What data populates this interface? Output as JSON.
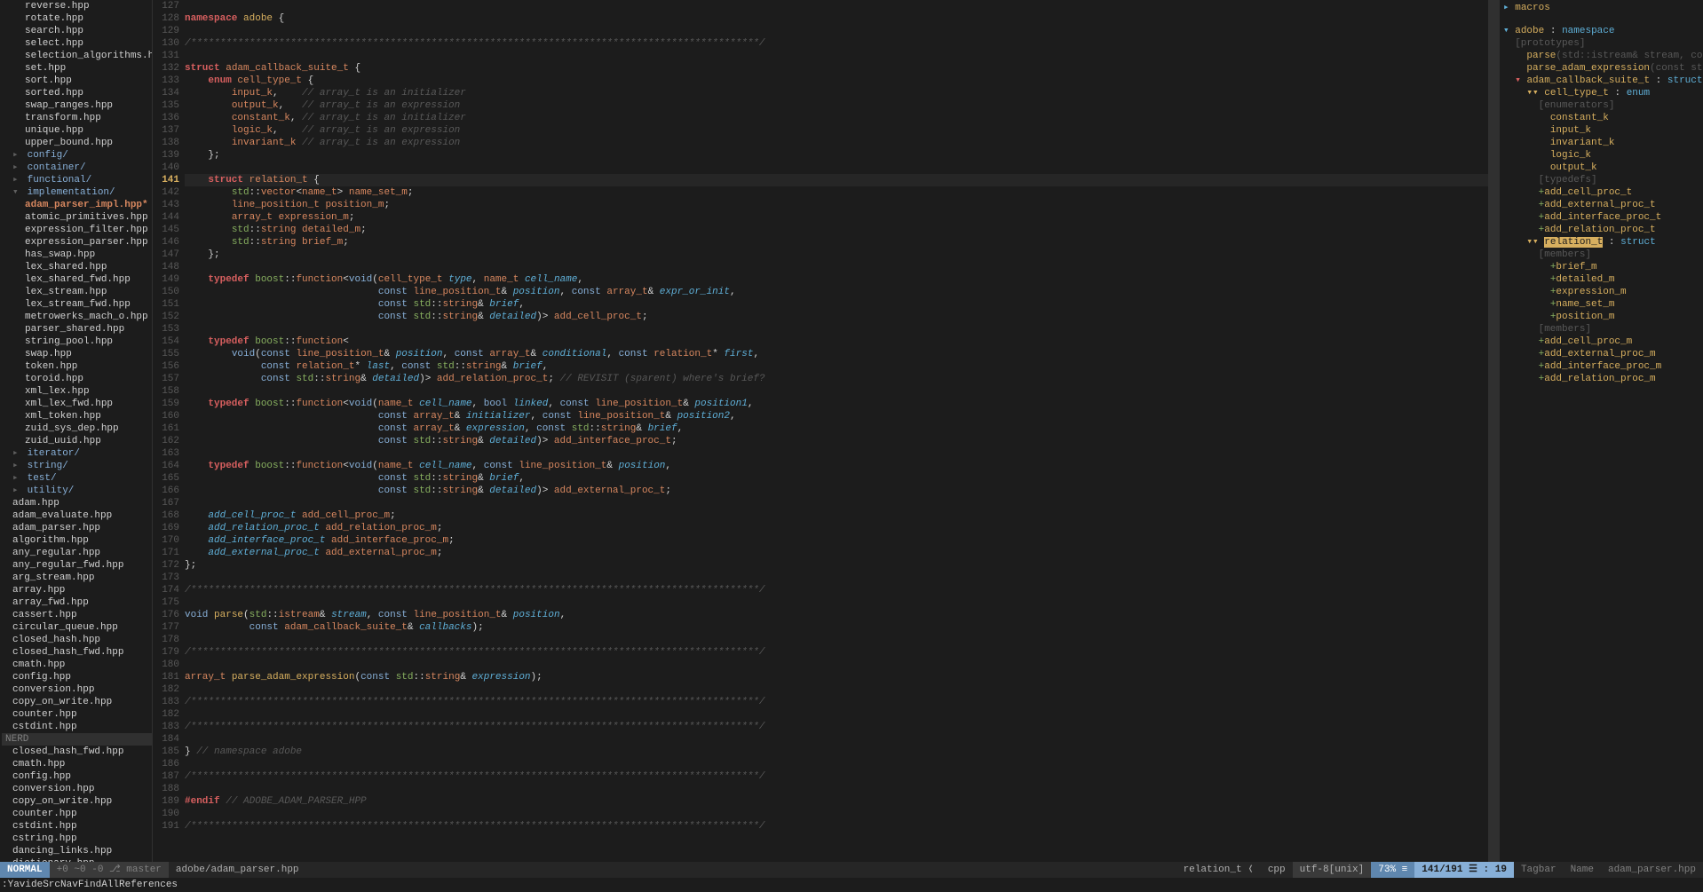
{
  "file_tree": {
    "items": [
      {
        "text": "reverse.hpp",
        "indent": 2
      },
      {
        "text": "rotate.hpp",
        "indent": 2
      },
      {
        "text": "search.hpp",
        "indent": 2
      },
      {
        "text": "select.hpp",
        "indent": 2
      },
      {
        "text": "selection_algorithms.hpp",
        "indent": 2
      },
      {
        "text": "set.hpp",
        "indent": 2
      },
      {
        "text": "sort.hpp",
        "indent": 2
      },
      {
        "text": "sorted.hpp",
        "indent": 2
      },
      {
        "text": "swap_ranges.hpp",
        "indent": 2
      },
      {
        "text": "transform.hpp",
        "indent": 2
      },
      {
        "text": "unique.hpp",
        "indent": 2
      },
      {
        "text": "upper_bound.hpp",
        "indent": 2
      },
      {
        "text": "config/",
        "indent": 1,
        "dir": true,
        "arrow": "▸"
      },
      {
        "text": "container/",
        "indent": 1,
        "dir": true,
        "arrow": "▸"
      },
      {
        "text": "functional/",
        "indent": 1,
        "dir": true,
        "arrow": "▸"
      },
      {
        "text": "implementation/",
        "indent": 1,
        "dir": true,
        "arrow": "▾"
      },
      {
        "text": "adam_parser_impl.hpp*",
        "indent": 2,
        "active": true
      },
      {
        "text": "atomic_primitives.hpp",
        "indent": 2
      },
      {
        "text": "expression_filter.hpp",
        "indent": 2
      },
      {
        "text": "expression_parser.hpp",
        "indent": 2
      },
      {
        "text": "has_swap.hpp",
        "indent": 2
      },
      {
        "text": "lex_shared.hpp",
        "indent": 2
      },
      {
        "text": "lex_shared_fwd.hpp",
        "indent": 2
      },
      {
        "text": "lex_stream.hpp",
        "indent": 2
      },
      {
        "text": "lex_stream_fwd.hpp",
        "indent": 2
      },
      {
        "text": "metrowerks_mach_o.hpp",
        "indent": 2
      },
      {
        "text": "parser_shared.hpp",
        "indent": 2
      },
      {
        "text": "string_pool.hpp",
        "indent": 2
      },
      {
        "text": "swap.hpp",
        "indent": 2
      },
      {
        "text": "token.hpp",
        "indent": 2
      },
      {
        "text": "toroid.hpp",
        "indent": 2
      },
      {
        "text": "xml_lex.hpp",
        "indent": 2
      },
      {
        "text": "xml_lex_fwd.hpp",
        "indent": 2
      },
      {
        "text": "xml_token.hpp",
        "indent": 2
      },
      {
        "text": "zuid_sys_dep.hpp",
        "indent": 2
      },
      {
        "text": "zuid_uuid.hpp",
        "indent": 2
      },
      {
        "text": "iterator/",
        "indent": 1,
        "dir": true,
        "arrow": "▸"
      },
      {
        "text": "string/",
        "indent": 1,
        "dir": true,
        "arrow": "▸"
      },
      {
        "text": "test/",
        "indent": 1,
        "dir": true,
        "arrow": "▸"
      },
      {
        "text": "utility/",
        "indent": 1,
        "dir": true,
        "arrow": "▸"
      },
      {
        "text": "adam.hpp",
        "indent": 1
      },
      {
        "text": "adam_evaluate.hpp",
        "indent": 1
      },
      {
        "text": "adam_parser.hpp",
        "indent": 1
      },
      {
        "text": "algorithm.hpp",
        "indent": 1
      },
      {
        "text": "any_regular.hpp",
        "indent": 1
      },
      {
        "text": "any_regular_fwd.hpp",
        "indent": 1
      },
      {
        "text": "arg_stream.hpp",
        "indent": 1
      },
      {
        "text": "array.hpp",
        "indent": 1
      },
      {
        "text": "array_fwd.hpp",
        "indent": 1
      },
      {
        "text": "cassert.hpp",
        "indent": 1
      },
      {
        "text": "circular_queue.hpp",
        "indent": 1
      },
      {
        "text": "closed_hash.hpp",
        "indent": 1
      },
      {
        "text": "closed_hash_fwd.hpp",
        "indent": 1
      },
      {
        "text": "cmath.hpp",
        "indent": 1
      },
      {
        "text": "config.hpp",
        "indent": 1
      },
      {
        "text": "conversion.hpp",
        "indent": 1
      },
      {
        "text": "copy_on_write.hpp",
        "indent": 1
      },
      {
        "text": "counter.hpp",
        "indent": 1
      },
      {
        "text": "cstdint.hpp",
        "indent": 1
      }
    ],
    "nerd1": "NERD",
    "items2": [
      {
        "text": "closed_hash_fwd.hpp",
        "indent": 1
      },
      {
        "text": "cmath.hpp",
        "indent": 1
      },
      {
        "text": "config.hpp",
        "indent": 1
      },
      {
        "text": "conversion.hpp",
        "indent": 1
      },
      {
        "text": "copy_on_write.hpp",
        "indent": 1
      },
      {
        "text": "counter.hpp",
        "indent": 1
      },
      {
        "text": "cstdint.hpp",
        "indent": 1
      },
      {
        "text": "cstring.hpp",
        "indent": 1
      },
      {
        "text": "dancing_links.hpp",
        "indent": 1
      },
      {
        "text": "dictionary.hpp",
        "indent": 1
      }
    ],
    "nerd2": "NERD"
  },
  "code": {
    "first_line": 127,
    "current_line": 141,
    "lines": [
      {
        "n": 127,
        "html": ""
      },
      {
        "n": 128,
        "html": "<span class='kw'>namespace</span> <span class='ns'>adobe</span> {"
      },
      {
        "n": 129,
        "html": ""
      },
      {
        "n": 130,
        "html": "<span class='comment'>/*************************************************************************************************/</span>"
      },
      {
        "n": 131,
        "html": ""
      },
      {
        "n": 132,
        "html": "<span class='kw'>struct</span> <span class='type'>adam_callback_suite_t</span> {"
      },
      {
        "n": 133,
        "html": "    <span class='kw'>enum</span> <span class='type'>cell_type_t</span> {"
      },
      {
        "n": 134,
        "html": "        <span class='type'>input_k</span>,    <span class='comment'>// array_t is an initializer</span>"
      },
      {
        "n": 135,
        "html": "        <span class='type'>output_k</span>,   <span class='comment'>// array_t is an expression</span>"
      },
      {
        "n": 136,
        "html": "        <span class='type'>constant_k</span>, <span class='comment'>// array_t is an initializer</span>"
      },
      {
        "n": 137,
        "html": "        <span class='type'>logic_k</span>,    <span class='comment'>// array_t is an expression</span>"
      },
      {
        "n": 138,
        "html": "        <span class='type'>invariant_k</span> <span class='comment'>// array_t is an expression</span>"
      },
      {
        "n": 139,
        "html": "    };"
      },
      {
        "n": 140,
        "html": ""
      },
      {
        "n": 141,
        "html": "    <span class='kw'>struct</span> <span class='type'>relation_t</span> {",
        "current": true
      },
      {
        "n": 142,
        "html": "        <span class='type2'>std</span>::<span class='type'>vector</span>&lt;<span class='type'>name_t</span>&gt; <span class='type'>name_set_m</span>;"
      },
      {
        "n": 143,
        "html": "        <span class='type'>line_position_t</span> <span class='type'>position_m</span>;"
      },
      {
        "n": 144,
        "html": "        <span class='type'>array_t</span> <span class='type'>expression_m</span>;"
      },
      {
        "n": 145,
        "html": "        <span class='type2'>std</span>::<span class='type'>string</span> <span class='type'>detailed_m</span>;"
      },
      {
        "n": 146,
        "html": "        <span class='type2'>std</span>::<span class='type'>string</span> <span class='type'>brief_m</span>;"
      },
      {
        "n": 147,
        "html": "    };"
      },
      {
        "n": 148,
        "html": ""
      },
      {
        "n": 149,
        "html": "    <span class='kw'>typedef</span> <span class='type2'>boost</span>::<span class='type'>function</span>&lt;<span class='kw2'>void</span>(<span class='type'>cell_type_t</span> <span class='ident'>type</span>, <span class='type'>name_t</span> <span class='ident'>cell_name</span>,"
      },
      {
        "n": 150,
        "html": "                                 <span class='kw2'>const</span> <span class='type'>line_position_t</span>&amp; <span class='ident'>position</span>, <span class='kw2'>const</span> <span class='type'>array_t</span>&amp; <span class='ident'>expr_or_init</span>,"
      },
      {
        "n": 151,
        "html": "                                 <span class='kw2'>const</span> <span class='type2'>std</span>::<span class='type'>string</span>&amp; <span class='ident'>brief</span>,"
      },
      {
        "n": 152,
        "html": "                                 <span class='kw2'>const</span> <span class='type2'>std</span>::<span class='type'>string</span>&amp; <span class='ident'>detailed</span>)&gt; <span class='type'>add_cell_proc_t</span>;"
      },
      {
        "n": 153,
        "html": ""
      },
      {
        "n": 154,
        "html": "    <span class='kw'>typedef</span> <span class='type2'>boost</span>::<span class='type'>function</span>&lt;"
      },
      {
        "n": 155,
        "html": "        <span class='kw2'>void</span>(<span class='kw2'>const</span> <span class='type'>line_position_t</span>&amp; <span class='ident'>position</span>, <span class='kw2'>const</span> <span class='type'>array_t</span>&amp; <span class='ident'>conditional</span>, <span class='kw2'>const</span> <span class='type'>relation_t</span>* <span class='ident'>first</span>,"
      },
      {
        "n": 156,
        "html": "             <span class='kw2'>const</span> <span class='type'>relation_t</span>* <span class='ident'>last</span>, <span class='kw2'>const</span> <span class='type2'>std</span>::<span class='type'>string</span>&amp; <span class='ident'>brief</span>,"
      },
      {
        "n": 157,
        "html": "             <span class='kw2'>const</span> <span class='type2'>std</span>::<span class='type'>string</span>&amp; <span class='ident'>detailed</span>)&gt; <span class='type'>add_relation_proc_t</span>; <span class='comment'>// REVISIT (sparent) where's brief?</span>"
      },
      {
        "n": 158,
        "html": ""
      },
      {
        "n": 159,
        "html": "    <span class='kw'>typedef</span> <span class='type2'>boost</span>::<span class='type'>function</span>&lt;<span class='kw2'>void</span>(<span class='type'>name_t</span> <span class='ident'>cell_name</span>, <span class='kw2'>bool</span> <span class='ident'>linked</span>, <span class='kw2'>const</span> <span class='type'>line_position_t</span>&amp; <span class='ident'>position1</span>,"
      },
      {
        "n": 160,
        "html": "                                 <span class='kw2'>const</span> <span class='type'>array_t</span>&amp; <span class='ident'>initializer</span>, <span class='kw2'>const</span> <span class='type'>line_position_t</span>&amp; <span class='ident'>position2</span>,"
      },
      {
        "n": 161,
        "html": "                                 <span class='kw2'>const</span> <span class='type'>array_t</span>&amp; <span class='ident'>expression</span>, <span class='kw2'>const</span> <span class='type2'>std</span>::<span class='type'>string</span>&amp; <span class='ident'>brief</span>,"
      },
      {
        "n": 162,
        "html": "                                 <span class='kw2'>const</span> <span class='type2'>std</span>::<span class='type'>string</span>&amp; <span class='ident'>detailed</span>)&gt; <span class='type'>add_interface_proc_t</span>;"
      },
      {
        "n": 163,
        "html": ""
      },
      {
        "n": 164,
        "html": "    <span class='kw'>typedef</span> <span class='type2'>boost</span>::<span class='type'>function</span>&lt;<span class='kw2'>void</span>(<span class='type'>name_t</span> <span class='ident'>cell_name</span>, <span class='kw2'>const</span> <span class='type'>line_position_t</span>&amp; <span class='ident'>position</span>,"
      },
      {
        "n": 165,
        "html": "                                 <span class='kw2'>const</span> <span class='type2'>std</span>::<span class='type'>string</span>&amp; <span class='ident'>brief</span>,"
      },
      {
        "n": 166,
        "html": "                                 <span class='kw2'>const</span> <span class='type2'>std</span>::<span class='type'>string</span>&amp; <span class='ident'>detailed</span>)&gt; <span class='type'>add_external_proc_t</span>;"
      },
      {
        "n": 167,
        "html": ""
      },
      {
        "n": 168,
        "html": "    <span class='ident'>add_cell_proc_t</span> <span class='type'>add_cell_proc_m</span>;"
      },
      {
        "n": 169,
        "html": "    <span class='ident'>add_relation_proc_t</span> <span class='type'>add_relation_proc_m</span>;"
      },
      {
        "n": 170,
        "html": "    <span class='ident'>add_interface_proc_t</span> <span class='type'>add_interface_proc_m</span>;"
      },
      {
        "n": 171,
        "html": "    <span class='ident'>add_external_proc_t</span> <span class='type'>add_external_proc_m</span>;"
      },
      {
        "n": 172,
        "html": "};"
      },
      {
        "n": 173,
        "html": ""
      },
      {
        "n": 174,
        "html": "<span class='comment'>/*************************************************************************************************/</span>"
      },
      {
        "n": 175,
        "html": ""
      },
      {
        "n": 176,
        "html": "<span class='kw2'>void</span> <span class='func'>parse</span>(<span class='type2'>std</span>::<span class='type'>istream</span>&amp; <span class='ident'>stream</span>, <span class='kw2'>const</span> <span class='type'>line_position_t</span>&amp; <span class='ident'>position</span>,"
      },
      {
        "n": 177,
        "html": "           <span class='kw2'>const</span> <span class='type'>adam_callback_suite_t</span>&amp; <span class='ident'>callbacks</span>);"
      },
      {
        "n": 178,
        "html": ""
      },
      {
        "n": 179,
        "html": "<span class='comment'>/*************************************************************************************************/</span>"
      },
      {
        "n": 180,
        "html": ""
      },
      {
        "n": 181,
        "html": "<span class='type'>array_t</span> <span class='func'>parse_adam_expression</span>(<span class='kw2'>const</span> <span class='type2'>std</span>::<span class='type'>string</span>&amp; <span class='ident'>expression</span>);"
      },
      {
        "n": 182,
        "html": ""
      },
      {
        "n": 183,
        "html": "<span class='comment'>/*************************************************************************************************/</span>"
      },
      {
        "n": 182,
        "html": ""
      },
      {
        "n": 183,
        "html": "<span class='comment'>/*************************************************************************************************/</span>"
      },
      {
        "n": 184,
        "html": ""
      },
      {
        "n": 185,
        "html": "} <span class='comment'>// namespace adobe</span>"
      },
      {
        "n": 186,
        "html": ""
      },
      {
        "n": 187,
        "html": "<span class='comment'>/*************************************************************************************************/</span>"
      },
      {
        "n": 188,
        "html": ""
      },
      {
        "n": 189,
        "html": "<span class='kw'>#endif</span> <span class='comment'>// ADOBE_ADAM_PARSER_HPP</span>"
      },
      {
        "n": 190,
        "html": ""
      },
      {
        "n": 191,
        "html": "<span class='comment'>/*************************************************************************************************/</span>"
      }
    ]
  },
  "tagbar": {
    "macros": "macros",
    "items": [
      {
        "arrow": "▾",
        "cls": "tag-arrow",
        "name": "adobe",
        "sep": " : ",
        "kind": "namespace",
        "indent": 0
      },
      {
        "header": "[prototypes]",
        "indent": 1
      },
      {
        "name": "parse",
        "dim": "(std::istream& stream, const li",
        "indent": 2
      },
      {
        "name": "parse_adam_expression",
        "dim": "(const std::str",
        "indent": 2
      },
      {
        "arrow": "▾",
        "cls": "tag-arrow-red",
        "name": "adam_callback_suite_t",
        "sep": " : ",
        "kind": "struct",
        "indent": 1
      },
      {
        "arrow": "▾▾",
        "cls": "tag-arrow-yel",
        "name": "cell_type_t",
        "sep": " : ",
        "kind": "enum",
        "indent": 2
      },
      {
        "header": "[enumerators]",
        "indent": 3
      },
      {
        "name": "constant_k",
        "indent": 4
      },
      {
        "name": "input_k",
        "indent": 4
      },
      {
        "name": "invariant_k",
        "indent": 4
      },
      {
        "name": "logic_k",
        "indent": 4
      },
      {
        "name": "output_k",
        "indent": 4
      },
      {
        "header": "[typedefs]",
        "indent": 3
      },
      {
        "plus": "+",
        "name": "add_cell_proc_t",
        "indent": 3
      },
      {
        "plus": "+",
        "name": "add_external_proc_t",
        "indent": 3
      },
      {
        "plus": "+",
        "name": "add_interface_proc_t",
        "indent": 3
      },
      {
        "plus": "+",
        "name": "add_relation_proc_t",
        "indent": 3
      },
      {
        "arrow": "▾▾",
        "cls": "tag-arrow-yel",
        "hl": true,
        "name": "relation_t",
        "sep": " : ",
        "kind": "struct",
        "indent": 2
      },
      {
        "header": "[members]",
        "indent": 3
      },
      {
        "plus": "+",
        "name": "brief_m",
        "indent": 4
      },
      {
        "plus": "+",
        "name": "detailed_m",
        "indent": 4
      },
      {
        "plus": "+",
        "name": "expression_m",
        "indent": 4
      },
      {
        "plus": "+",
        "name": "name_set_m",
        "indent": 4
      },
      {
        "plus": "+",
        "name": "position_m",
        "indent": 4
      },
      {
        "header": "[members]",
        "indent": 3
      },
      {
        "plus": "+",
        "name": "add_cell_proc_m",
        "indent": 3
      },
      {
        "plus": "+",
        "name": "add_external_proc_m",
        "indent": 3
      },
      {
        "plus": "+",
        "name": "add_interface_proc_m",
        "indent": 3
      },
      {
        "plus": "+",
        "name": "add_relation_proc_m",
        "indent": 3
      }
    ]
  },
  "status": {
    "mode": "NORMAL",
    "git": "+0 ~0 -0 ⎇ master",
    "file": "adobe/adam_parser.hpp",
    "symbol": "relation_t ❬",
    "filetype": "cpp",
    "encoding": "utf-8[unix]",
    "percent": "73% ≡",
    "position": "141/191 ☰ : 19",
    "tagbar_label": "Tagbar",
    "tagbar_kind": "Name",
    "tagbar_file": "adam_parser.hpp"
  },
  "cmdline": ":YavideSrcNavFindAllReferences"
}
